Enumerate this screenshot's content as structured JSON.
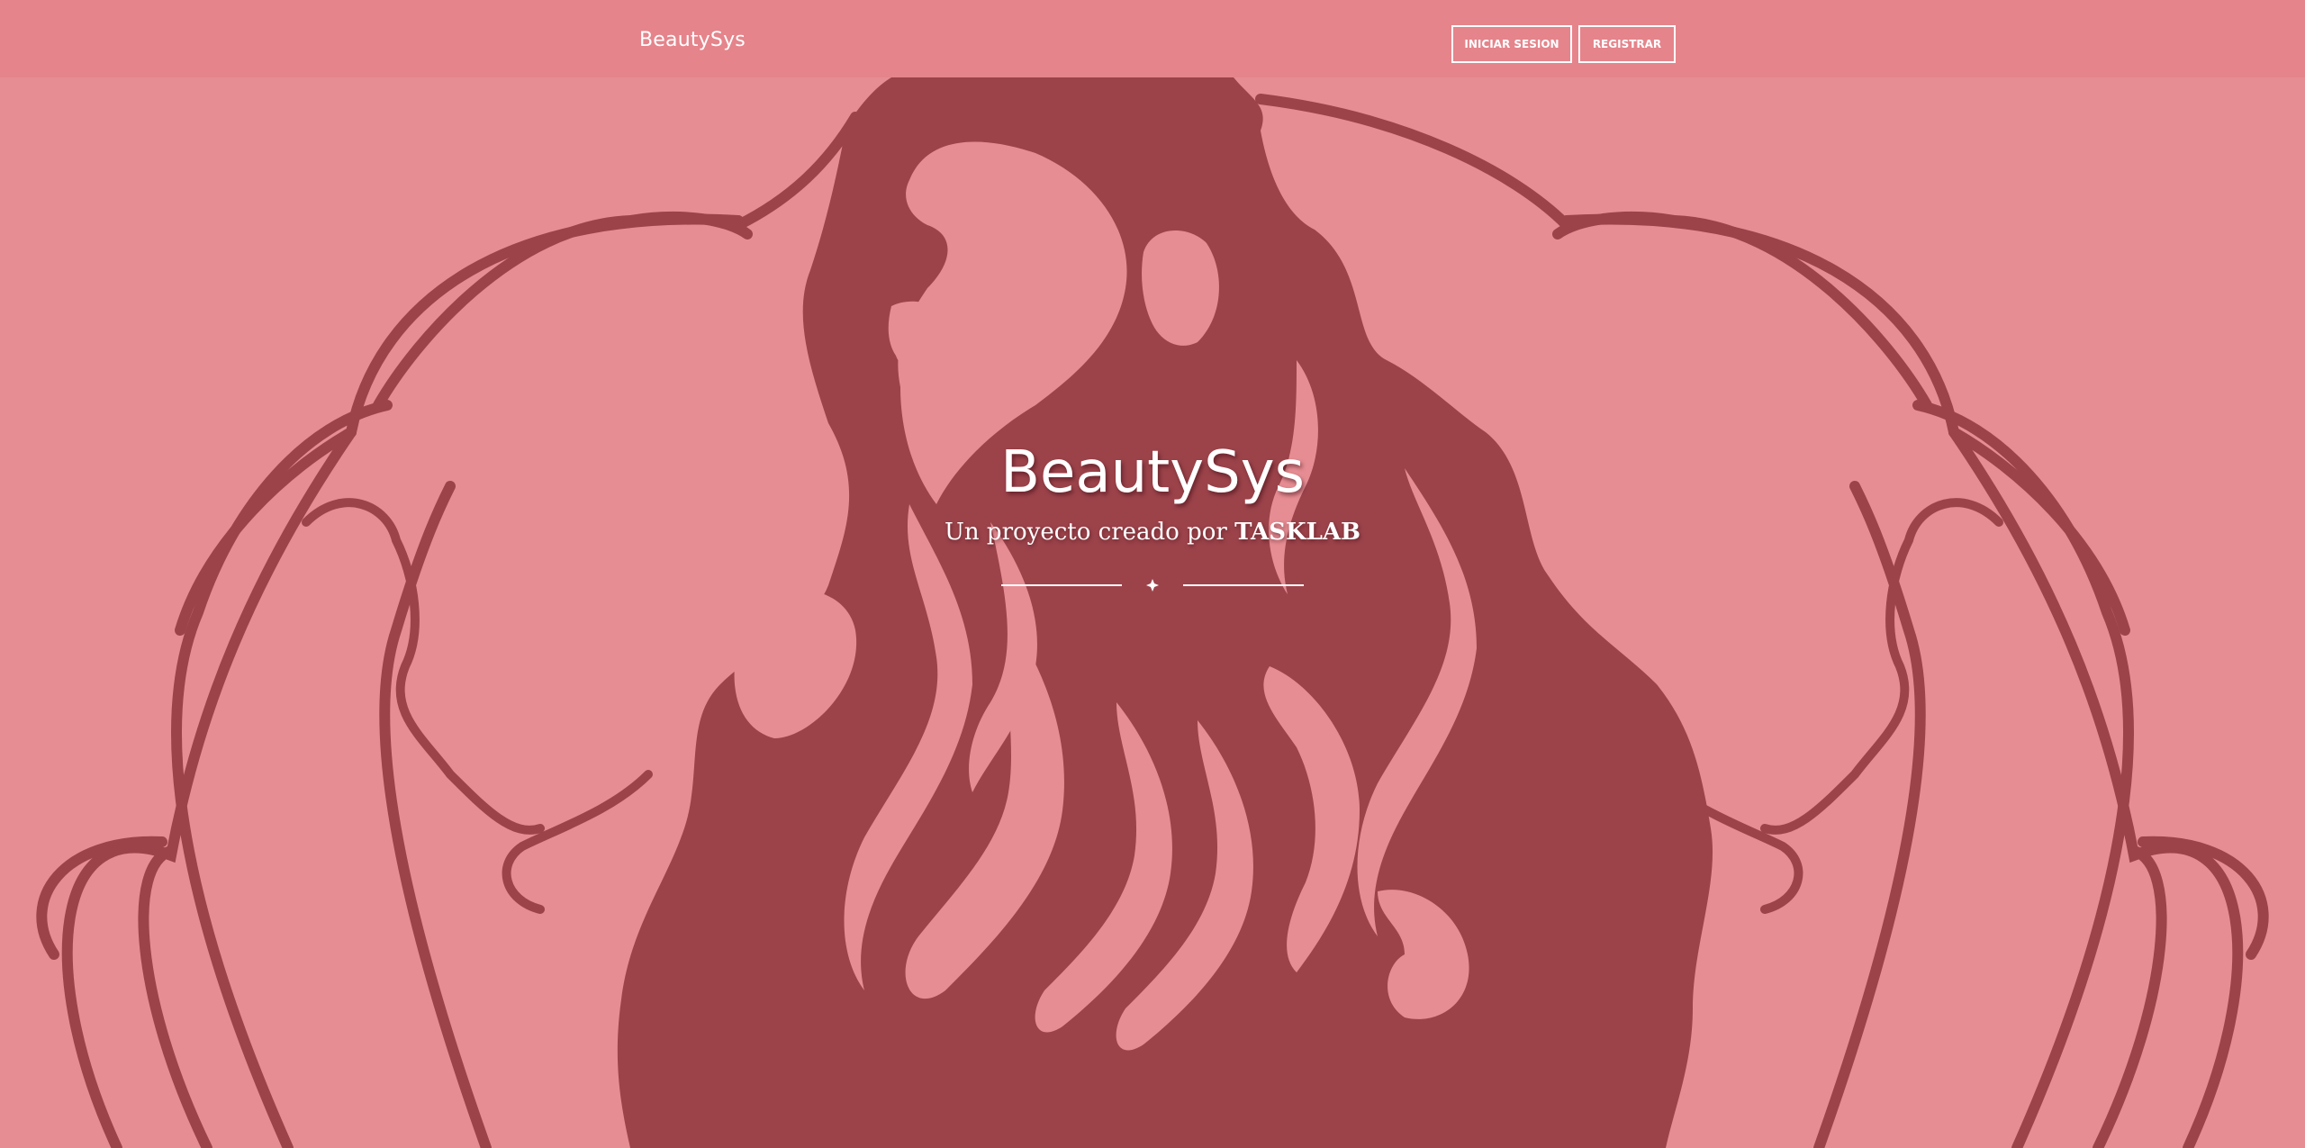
{
  "navbar": {
    "brand": "BeautySys",
    "login_label": "INICIAR SESION",
    "register_label": "REGISTRAR"
  },
  "hero": {
    "title": "BeautySys",
    "subtitle_prefix": "Un proyecto creado por ",
    "subtitle_strong": "TASKLAB",
    "divider_icon": "star-icon"
  },
  "colors": {
    "background": "#e68d93",
    "navbar": "#e5848b",
    "illustration": "#9c434a",
    "text": "#ffffff"
  }
}
